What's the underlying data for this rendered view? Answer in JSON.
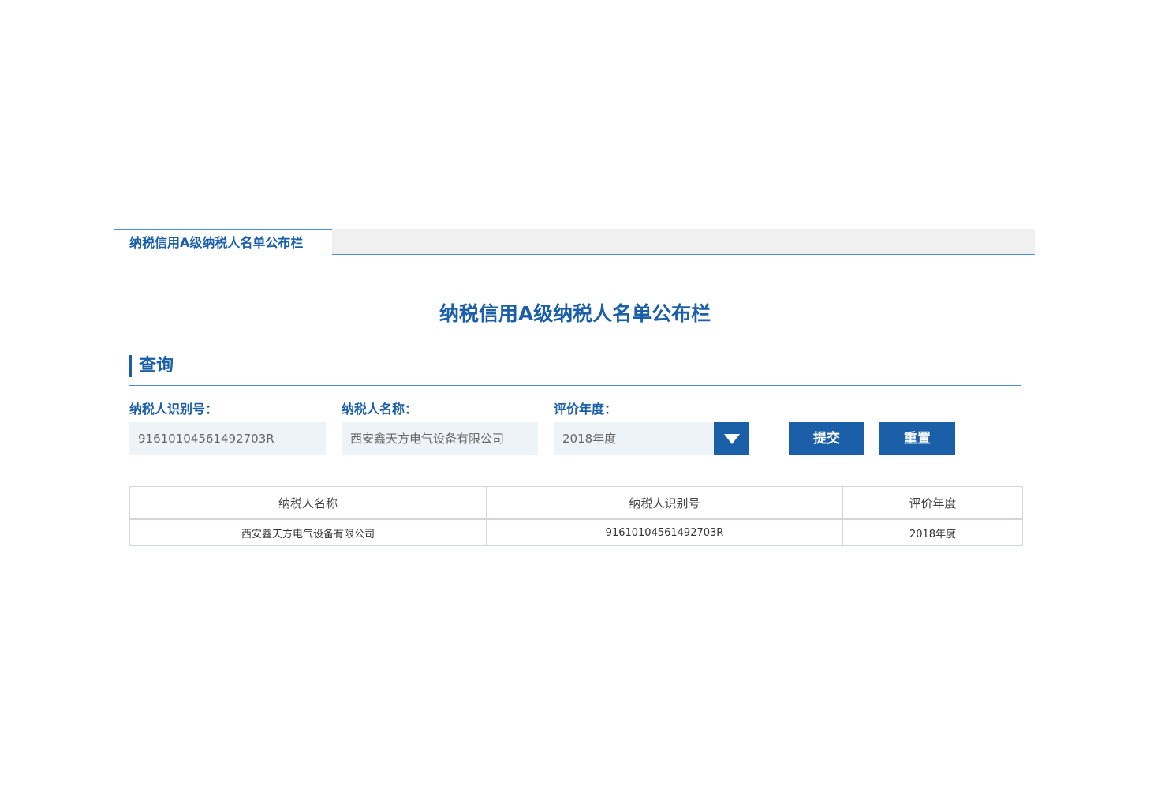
{
  "tab": {
    "label": "纳税信用A级纳税人名单公布栏"
  },
  "main_title": "纳税信用A级纳税人名单公布栏",
  "section": {
    "title": "查询"
  },
  "form": {
    "taxpayer_id_label": "纳税人识别号：",
    "taxpayer_id_value": "91610104561492703R",
    "taxpayer_name_label": "纳税人名称：",
    "taxpayer_name_value": "西安鑫天方电气设备有限公司",
    "eval_year_label": "评价年度：",
    "eval_year_value": "2018年度",
    "submit_label": "提交",
    "reset_label": "重置"
  },
  "table": {
    "headers": [
      "纳税人名称",
      "纳税人识别号",
      "评价年度"
    ],
    "rows": [
      [
        "西安鑫天方电气设备有限公司",
        "91610104561492703R",
        "2018年度"
      ]
    ]
  },
  "colors": {
    "accent": "#1a5fa8",
    "input_bg": "#eef3f8"
  }
}
